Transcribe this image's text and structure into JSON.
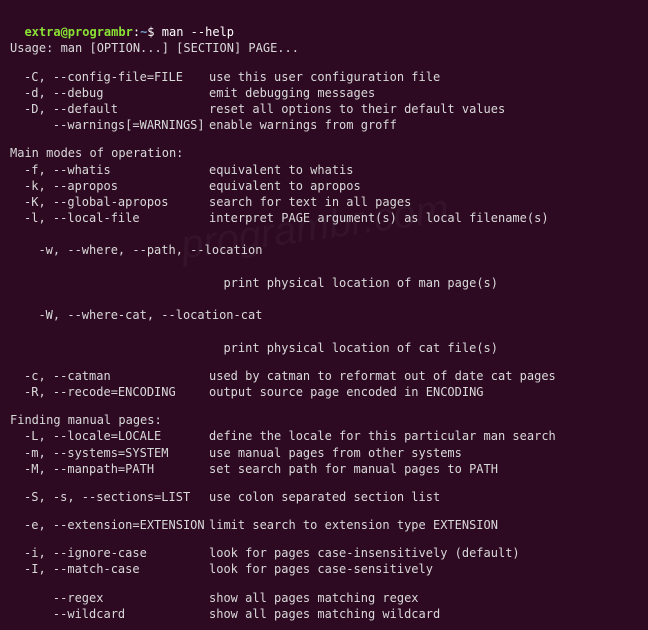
{
  "prompt": {
    "user_host": "extra@programbr",
    "path": "~",
    "dollar": "$",
    "command": "man --help"
  },
  "usage": "Usage: man [OPTION...] [SECTION] PAGE...",
  "opts1": [
    {
      "flags": "-C, --config-file=FILE",
      "desc": "use this user configuration file"
    },
    {
      "flags": "-d, --debug",
      "desc": "emit debugging messages"
    },
    {
      "flags": "-D, --default",
      "desc": "reset all options to their default values"
    },
    {
      "flags": "    --warnings[=WARNINGS]",
      "desc": "enable warnings from groff"
    }
  ],
  "sec_modes": "Main modes of operation:",
  "opts2": [
    {
      "flags": "-f, --whatis",
      "desc": "equivalent to whatis"
    },
    {
      "flags": "-k, --apropos",
      "desc": "equivalent to apropos"
    },
    {
      "flags": "-K, --global-apropos",
      "desc": "search for text in all pages"
    },
    {
      "flags": "-l, --local-file",
      "desc": "interpret PAGE argument(s) as local filename(s)"
    }
  ],
  "optw": {
    "flags": "-w, --where, --path, --location",
    "desc": "print physical location of man page(s)"
  },
  "optW": {
    "flags": "-W, --where-cat, --location-cat",
    "desc": "print physical location of cat file(s)"
  },
  "opts3": [
    {
      "flags": "-c, --catman",
      "desc": "used by catman to reformat out of date cat pages"
    },
    {
      "flags": "-R, --recode=ENCODING",
      "desc": "output source page encoded in ENCODING"
    }
  ],
  "sec_finding": "Finding manual pages:",
  "opts4": [
    {
      "flags": "-L, --locale=LOCALE",
      "desc": "define the locale for this particular man search"
    },
    {
      "flags": "-m, --systems=SYSTEM",
      "desc": "use manual pages from other systems"
    },
    {
      "flags": "-M, --manpath=PATH",
      "desc": "set search path for manual pages to PATH"
    }
  ],
  "opts5": [
    {
      "flags": "-S, -s, --sections=LIST",
      "desc": "use colon separated section list"
    }
  ],
  "opts6": [
    {
      "flags": "-e, --extension=EXTENSION",
      "desc": "limit search to extension type EXTENSION"
    }
  ],
  "opts7": [
    {
      "flags": "-i, --ignore-case",
      "desc": "look for pages case-insensitively (default)"
    },
    {
      "flags": "-I, --match-case",
      "desc": "look for pages case-sensitively"
    }
  ],
  "opts8": [
    {
      "flags": "    --regex",
      "desc": "show all pages matching regex"
    },
    {
      "flags": "    --wildcard",
      "desc": "show all pages matching wildcard"
    }
  ],
  "watermark": "programbr.com"
}
